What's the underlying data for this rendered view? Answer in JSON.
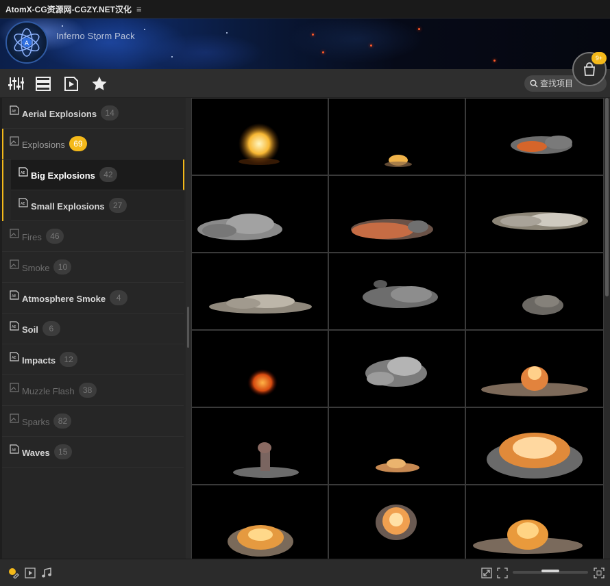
{
  "window": {
    "title": "AtomX-CG资源网-CGZY.NET汉化",
    "menu_glyph": "≡"
  },
  "banner": {
    "pack_title": "Inferno Storm Pack"
  },
  "cart": {
    "badge": "9+"
  },
  "toolbar": {
    "tools": [
      "sliders-icon",
      "list-view-icon",
      "media-preview-icon",
      "star-favorites-icon"
    ],
    "search_placeholder": "查找项目"
  },
  "sidebar": {
    "categories": [
      {
        "label": "Aerial Explosions",
        "count": "14"
      },
      {
        "label": "Explosions",
        "count": "69"
      },
      {
        "label": "Big Explosions",
        "count": "42"
      },
      {
        "label": "Small Explosions",
        "count": "27"
      },
      {
        "label": "Fires",
        "count": "46"
      },
      {
        "label": "Smoke",
        "count": "10"
      },
      {
        "label": "Atmosphere Smoke",
        "count": "4"
      },
      {
        "label": "Soil",
        "count": "6"
      },
      {
        "label": "Impacts",
        "count": "12"
      },
      {
        "label": "Muzzle Flash",
        "count": "38"
      },
      {
        "label": "Sparks",
        "count": "82"
      },
      {
        "label": "Waves",
        "count": "15"
      }
    ]
  },
  "grid": {
    "thumbnails": [
      "fireball-explosion",
      "small-ground-burst",
      "flat-fire-smoke-cloud",
      "grey-smoke-cloud",
      "orange-smoke-cloud",
      "white-smoke-plume",
      "low-dust-cloud",
      "drifting-smoke",
      "small-smoke-puff",
      "orange-fireball",
      "grey-smoke-billow",
      "ground-explosion-debris",
      "smoke-column",
      "low-flame-burst",
      "large-fire-mushroom",
      "fireball-smoke",
      "hanging-fire-cloud",
      "ground-fire-burst"
    ]
  },
  "footer": {
    "status_color": "#f4b91a",
    "zoom_level": 0.5
  }
}
